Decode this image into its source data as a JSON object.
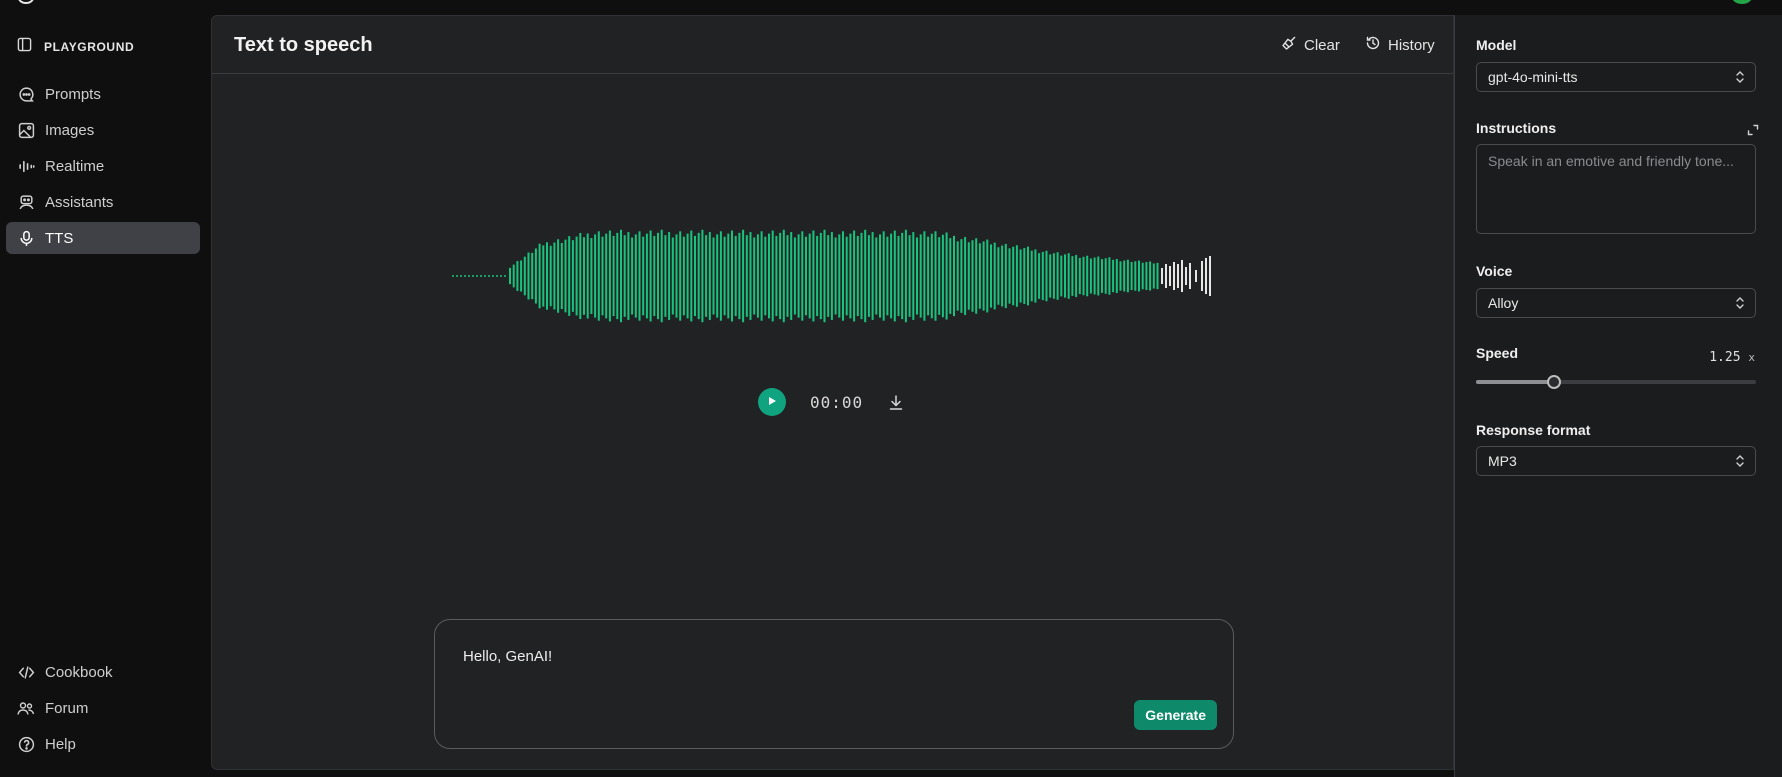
{
  "sidebar": {
    "header": "PLAYGROUND",
    "items": [
      {
        "label": "Prompts",
        "icon": "chat-icon",
        "active": false
      },
      {
        "label": "Images",
        "icon": "image-icon",
        "active": false
      },
      {
        "label": "Realtime",
        "icon": "audio-bars-icon",
        "active": false
      },
      {
        "label": "Assistants",
        "icon": "robot-icon",
        "active": false
      },
      {
        "label": "TTS",
        "icon": "microphone-icon",
        "active": true
      }
    ],
    "bottom_items": [
      {
        "label": "Cookbook",
        "icon": "code-icon"
      },
      {
        "label": "Forum",
        "icon": "people-icon"
      },
      {
        "label": "Help",
        "icon": "help-icon"
      }
    ]
  },
  "main": {
    "title": "Text to speech",
    "clear_label": "Clear",
    "history_label": "History",
    "time": "00:00",
    "input_text": "Hello, GenAI!",
    "generate_label": "Generate"
  },
  "settings": {
    "model_label": "Model",
    "model_value": "gpt-4o-mini-tts",
    "instructions_label": "Instructions",
    "instructions_placeholder": "Speak in an emotive and friendly tone...",
    "voice_label": "Voice",
    "voice_value": "Alloy",
    "speed_label": "Speed",
    "speed_value": "1.25",
    "speed_unit": "x",
    "speed_fraction": 0.28,
    "format_label": "Response format",
    "format_value": "MP3"
  },
  "colors": {
    "accent": "#10a37f",
    "waveform_played": "#19c37d",
    "waveform_unplayed": "#e6e6e6",
    "generate_button": "#0e8a6b"
  }
}
